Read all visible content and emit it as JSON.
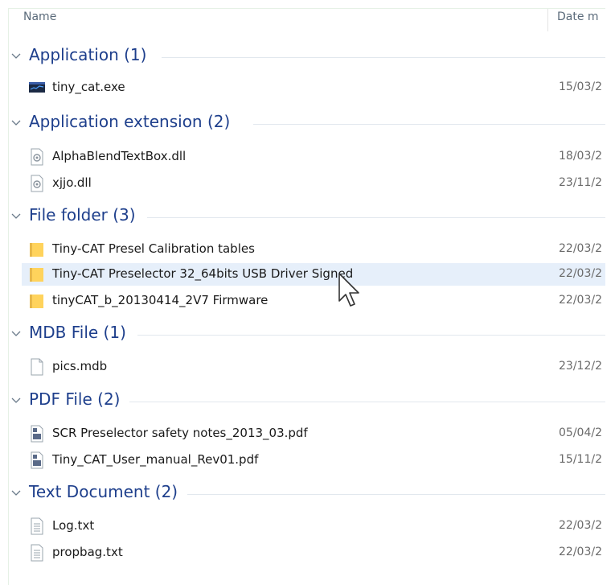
{
  "header": {
    "name": "Name",
    "date": "Date m"
  },
  "groups": [
    {
      "title": "Application (1)",
      "items": [
        {
          "name": "tiny_cat.exe",
          "date": "15/03/2",
          "icon": "exe-icon"
        }
      ]
    },
    {
      "title": "Application extension (2)",
      "items": [
        {
          "name": "AlphaBlendTextBox.dll",
          "date": "18/03/2",
          "icon": "dll-icon"
        },
        {
          "name": "xjjo.dll",
          "date": "23/11/2",
          "icon": "dll-icon"
        }
      ]
    },
    {
      "title": "File folder (3)",
      "items": [
        {
          "name": "Tiny-CAT Presel Calibration tables",
          "date": "22/03/2",
          "icon": "folder-icon"
        },
        {
          "name": "Tiny-CAT Preselector 32_64bits USB Driver Signed",
          "date": "22/03/2",
          "icon": "folder-icon"
        },
        {
          "name": "tinyCAT_b_20130414_2V7 Firmware",
          "date": "22/03/2",
          "icon": "folder-icon"
        }
      ]
    },
    {
      "title": "MDB File (1)",
      "items": [
        {
          "name": "pics.mdb",
          "date": "23/12/2",
          "icon": "blank-file-icon"
        }
      ]
    },
    {
      "title": "PDF File (2)",
      "items": [
        {
          "name": "SCR Preselector safety notes_2013_03.pdf",
          "date": "05/04/2",
          "icon": "pdf-icon"
        },
        {
          "name": "Tiny_CAT_User_manual_Rev01.pdf",
          "date": "15/11/2",
          "icon": "pdf-icon"
        }
      ]
    },
    {
      "title": "Text Document (2)",
      "items": [
        {
          "name": "Log.txt",
          "date": "22/03/2",
          "icon": "text-file-icon"
        },
        {
          "name": "propbag.txt",
          "date": "22/03/2",
          "icon": "text-file-icon"
        }
      ]
    }
  ],
  "colors": {
    "group_title": "#1e3f8c",
    "selected_row": "#e6effa",
    "folder": "#ffd35c"
  }
}
